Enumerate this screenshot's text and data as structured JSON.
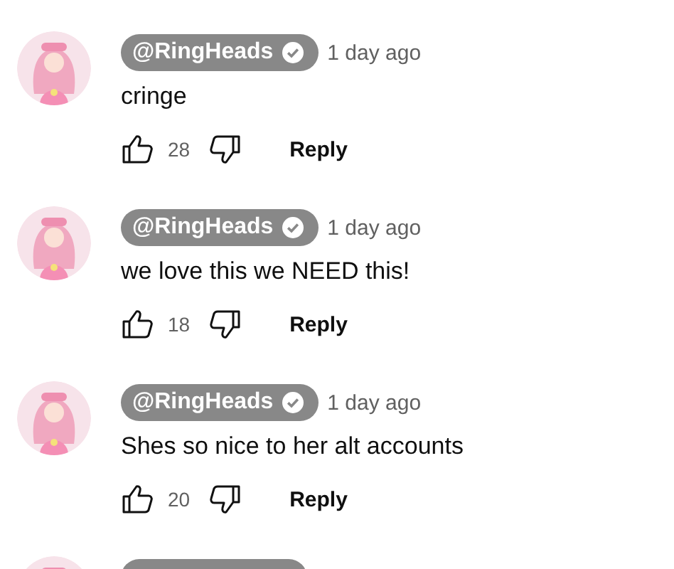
{
  "comments": [
    {
      "handle": "@RingHeads",
      "verified": true,
      "time": "1 day ago",
      "text": "cringe",
      "likes": "28",
      "reply": "Reply"
    },
    {
      "handle": "@RingHeads",
      "verified": true,
      "time": "1 day ago",
      "text": "we love this we NEED this!",
      "likes": "18",
      "reply": "Reply"
    },
    {
      "handle": "@RingHeads",
      "verified": true,
      "time": "1 day ago",
      "text": "Shes so nice to her alt accounts",
      "likes": "20",
      "reply": "Reply"
    }
  ],
  "more_below": true
}
